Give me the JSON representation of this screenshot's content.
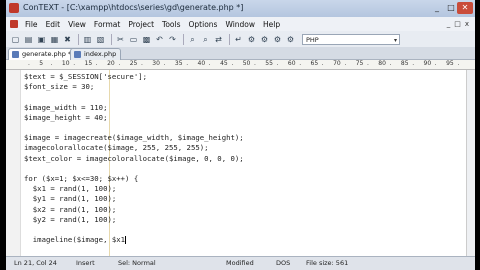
{
  "window": {
    "title": "ConTEXT - [C:\\xampp\\htdocs\\series\\gd\\generate.php *]",
    "buttons": [
      "_",
      "□",
      "✕"
    ]
  },
  "menu": {
    "items": [
      "File",
      "Edit",
      "View",
      "Format",
      "Project",
      "Tools",
      "Options",
      "Window",
      "Help"
    ],
    "mdi_buttons": [
      "_",
      "□",
      "x"
    ]
  },
  "toolbar": {
    "icons": [
      "new-file-icon",
      "open-folder-icon",
      "save-icon",
      "save-all-icon",
      "close-icon",
      "print-icon",
      "preview-icon",
      "cut-icon",
      "copy-icon",
      "paste-icon",
      "undo-icon",
      "redo-icon",
      "find-icon",
      "find-next-icon",
      "replace-icon",
      "word-wrap-icon",
      "f9-run-icon",
      "f10-run-icon",
      "f11-run-icon",
      "f12-run-icon"
    ],
    "glyphs": [
      "▢",
      "▤",
      "▣",
      "▦",
      "✖",
      "▥",
      "▧",
      "✂",
      "▭",
      "▩",
      "↶",
      "↷",
      "⌕",
      "⌕",
      "⇄",
      "↵",
      "⚙",
      "⚙",
      "⚙",
      "⚙"
    ],
    "language_select": "PHP"
  },
  "tabs": [
    {
      "label": "generate.php *",
      "active": true
    },
    {
      "label": "index.php",
      "active": false
    }
  ],
  "ruler": {
    "ticks": [
      ".",
      "5",
      ".",
      "10",
      ".",
      "15",
      ".",
      "20",
      ".",
      "25",
      ".",
      "30",
      ".",
      "35",
      ".",
      "40",
      ".",
      "45",
      ".",
      "50",
      ".",
      "55",
      ".",
      "60",
      ".",
      "65",
      ".",
      "70",
      ".",
      "75",
      ".",
      "80",
      ".",
      "85",
      ".",
      "90",
      ".",
      "95",
      "."
    ]
  },
  "editor": {
    "lines": [
      "$text = $_SESSION['secure'];",
      "$font_size = 30;",
      "",
      "$image_width = 110;",
      "$image_height = 40;",
      "",
      "$image = imagecreate($image_width, $image_height);",
      "imagecolorallocate($image, 255, 255, 255);",
      "$text_color = imagecolorallocate($image, 0, 0, 0);",
      "",
      "for ($x=1; $x<=30; $x++) {",
      "  $x1 = rand(1, 100);",
      "  $y1 = rand(1, 100);",
      "  $x2 = rand(1, 100);",
      "  $y2 = rand(1, 100);",
      "",
      "  imageline($image, $x1"
    ],
    "colors": {
      "text": "#222222",
      "background": "#ffffff",
      "gutter": "#f2f2f2"
    }
  },
  "status": {
    "position": "Ln 21, Col 24",
    "insert_mode": "Insert",
    "selection": "Sel: Normal",
    "modified": "Modified",
    "line_endings": "DOS",
    "file_size": "File size: 561"
  }
}
